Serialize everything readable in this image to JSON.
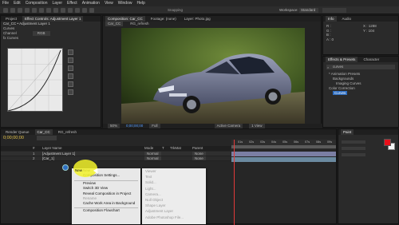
{
  "menubar": {
    "items": [
      "File",
      "Edit",
      "Composition",
      "Layer",
      "Effect",
      "Animation",
      "View",
      "Window",
      "Help"
    ],
    "snapping": "Snapping",
    "workspace_label": "Workspace:",
    "workspace_value": "Standard"
  },
  "effect_controls": {
    "tabs": [
      "Project",
      "Effect Controls: Adjustment Layer 1"
    ],
    "breadcrumb": "Car_CC • Adjustment Layer 1",
    "curves_label": "Curves",
    "channel_label": "Channel",
    "channel_value": "RGB",
    "fx_label": "fx Curves"
  },
  "composition": {
    "tab": "Composition: Car_CC",
    "tab2": "Footage: (none)",
    "tab3": "Layer: Photo.jpg",
    "breadcrumb": "Car_CC",
    "breadcrumb2": "RG_refresh",
    "zoom": "50%",
    "timecode": "0;00;00;00",
    "resolution": "Full",
    "view": "Active Camera",
    "views": "1 View"
  },
  "info_panel": {
    "tabs": [
      "Info",
      "Audio"
    ],
    "r": "R :",
    "g": "G :",
    "b": "B :",
    "a": "A : 0",
    "x": "X : 1288",
    "y": "Y : 104"
  },
  "effects_presets": {
    "tabs": [
      "Effects & Presets",
      "Character"
    ],
    "search_value": "curves",
    "items": [
      "* Animation Presets",
      "Backgrounds",
      "Imaging Curves",
      "Color Correction",
      "Curves"
    ]
  },
  "timeline": {
    "tabs": [
      "Render Queue",
      "Car_CC",
      "RG_refresh"
    ],
    "timecode": "0;00;00;00",
    "columns": [
      "#",
      "Layer Name",
      "Mode",
      "T",
      "TrkMat",
      "Parent"
    ],
    "layers": [
      {
        "num": "1",
        "name": "[Adjustment Layer 1]",
        "mode": "Normal",
        "parent": "None"
      },
      {
        "num": "2",
        "name": "[Car_1]",
        "mode": "Normal",
        "parent": "None"
      }
    ],
    "ruler": [
      "01s",
      "02s",
      "03s",
      "04s",
      "05s",
      "06s",
      "07s",
      "08s",
      "09s"
    ]
  },
  "context_menu": {
    "items": [
      "New",
      "Composition Settings...",
      "Preview",
      "Switch 3D View",
      "Reveal Composition in Project",
      "Rename",
      "Cache Work Area in Background",
      "Composition Flowchart"
    ]
  },
  "submenu": {
    "items": [
      "Viewer",
      "Text",
      "Solid...",
      "Light...",
      "Camera...",
      "Null Object",
      "Shape Layer",
      "Adjustment Layer",
      "Adobe Photoshop File..."
    ]
  },
  "paint_panel": {
    "tab": "Paint",
    "foreground_color": "#e8101a",
    "background_color": "#f4f4f4"
  },
  "colors": {
    "accent": "#2f6fc2",
    "highlight": "#f2f22a"
  }
}
